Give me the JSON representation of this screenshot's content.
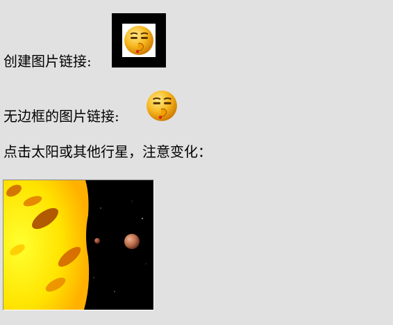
{
  "lines": {
    "bordered_link": "创建图片链接:",
    "borderless_link": "无边框的图片链接:",
    "instruction": "点击太阳或其他行星，注意变化："
  },
  "icons": {
    "smiley": "shush-smiley-icon"
  },
  "image_map": {
    "targets": [
      "sun",
      "planet-small",
      "planet-large"
    ]
  },
  "colors": {
    "page_background": "#e1e1e1",
    "border": "#000000",
    "sun": "#ffe800",
    "space": "#000000"
  }
}
